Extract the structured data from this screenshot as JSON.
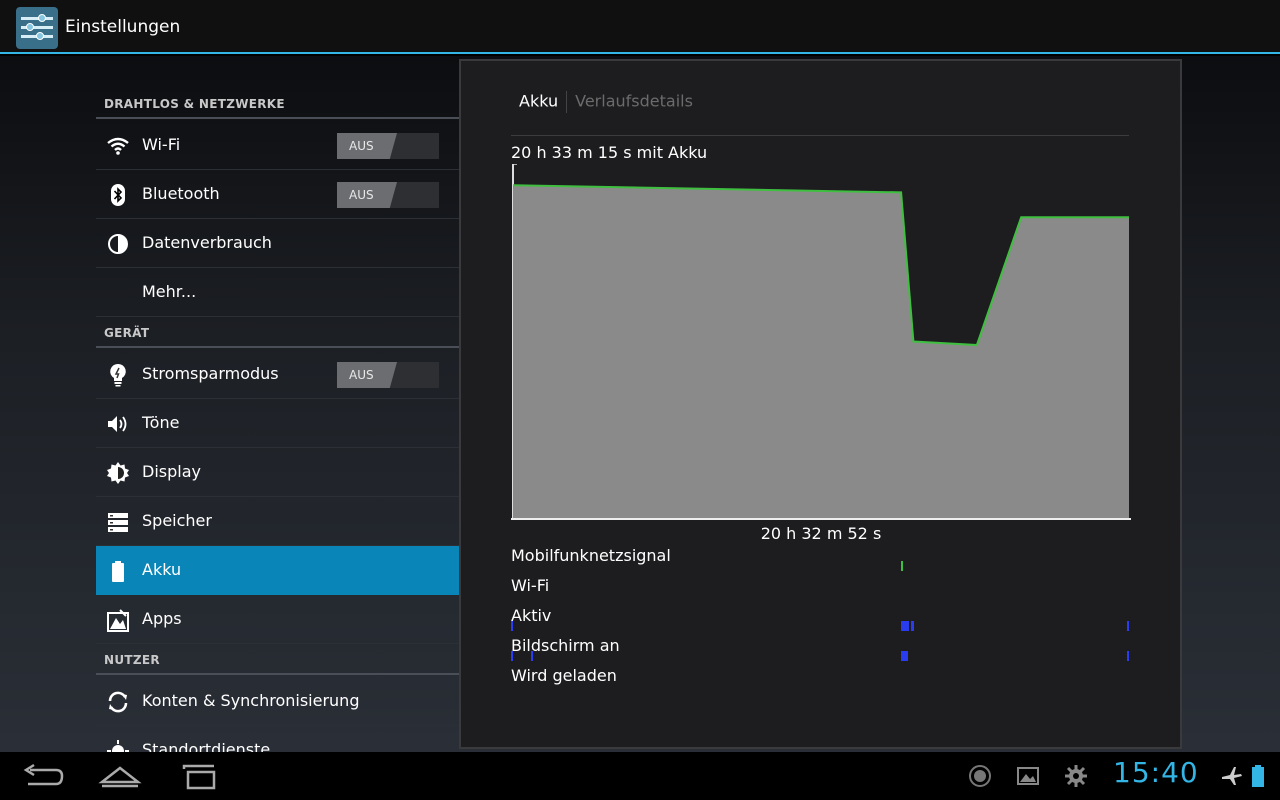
{
  "actionbar": {
    "title": "Einstellungen"
  },
  "sections": {
    "wireless": "DRAHTLOS & NETZWERKE",
    "device": "GERÄT",
    "user": "NUTZER"
  },
  "items": {
    "wifi": {
      "label": "Wi-Fi",
      "toggle": "AUS"
    },
    "bluetooth": {
      "label": "Bluetooth",
      "toggle": "AUS"
    },
    "data": {
      "label": "Datenverbrauch"
    },
    "more": {
      "label": "Mehr..."
    },
    "power": {
      "label": "Stromsparmodus",
      "toggle": "AUS"
    },
    "sound": {
      "label": "Töne"
    },
    "display": {
      "label": "Display"
    },
    "storage": {
      "label": "Speicher"
    },
    "battery": {
      "label": "Akku"
    },
    "apps": {
      "label": "Apps"
    },
    "accounts": {
      "label": "Konten & Synchronisierung"
    },
    "location": {
      "label": "Standortdienste"
    }
  },
  "panel": {
    "tab_active": "Akku",
    "tab_inactive": "Verlaufsdetails",
    "duration": "20 h 33 m 15 s mit Akku",
    "x_label": "20 h 32 m 52 s",
    "rows": [
      "Mobilfunknetzsignal",
      "Wi-Fi",
      "Aktiv",
      "Bildschirm an",
      "Wird geladen"
    ]
  },
  "chart_data": {
    "type": "area",
    "x": [
      0,
      0.63,
      0.65,
      0.753,
      0.825,
      1.0
    ],
    "values": [
      94,
      92,
      50,
      49,
      85,
      85
    ],
    "ylim": [
      0,
      100
    ],
    "fill_color": "#8a8a8a",
    "line_color": "#3fbf3f",
    "grid": false
  },
  "statusbar": {
    "time": "15:40"
  },
  "colors": {
    "accent": "#33b5e5",
    "active_item": "#0a85b8"
  }
}
